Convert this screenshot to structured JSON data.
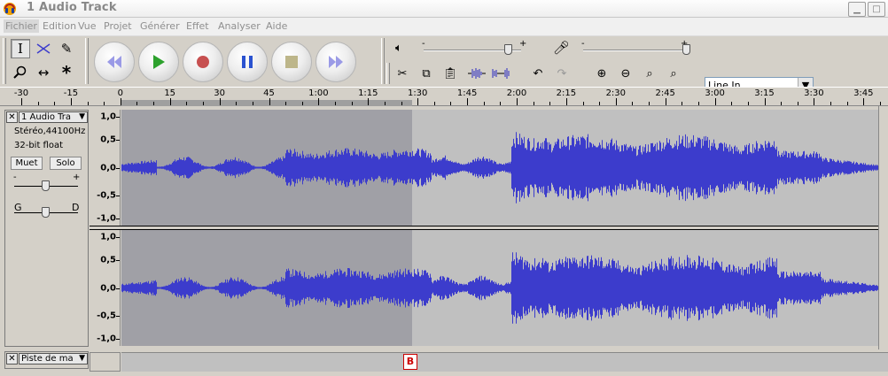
{
  "window": {
    "title": "1 Audio Track"
  },
  "menu": [
    "Fichier",
    "Edition",
    "Vue",
    "Projet",
    "Générer",
    "Effet",
    "Analyser",
    "Aide"
  ],
  "toolbar": {
    "input_source": "Line In",
    "playback_volume": 0.86,
    "record_volume": 1.0
  },
  "ruler": {
    "ticks": [
      "-30",
      "-15",
      "0",
      "15",
      "30",
      "45",
      "1:00",
      "1:15",
      "1:30",
      "1:45",
      "2:00",
      "2:15",
      "2:30",
      "2:45",
      "3:00",
      "3:15",
      "3:30",
      "3:45"
    ]
  },
  "track": {
    "name": "1 Audio Tra",
    "format": "Stéréo,44100Hz",
    "bitdepth": "32-bit float",
    "mute_label": "Muet",
    "solo_label": "Solo",
    "gain_minus": "-",
    "gain_plus": "+",
    "pan_left": "G",
    "pan_right": "D",
    "scale": [
      "1,0",
      "0,5",
      "0,0",
      "-0,5",
      "-1,0"
    ]
  },
  "label_track": {
    "name": "Piste de ma",
    "label_text": "B"
  },
  "colors": {
    "waveform": "#3c3ccc",
    "selected_bg": "#a0a0a6",
    "unselected_bg": "#c0c0c0"
  }
}
